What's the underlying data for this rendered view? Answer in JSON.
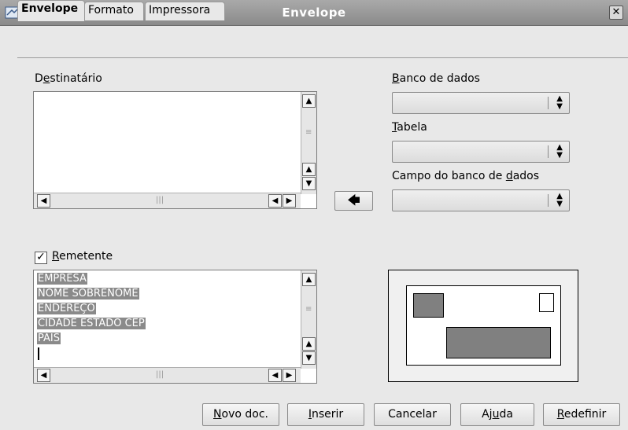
{
  "window": {
    "title": "Envelope",
    "close_label": "✕"
  },
  "tabs": [
    {
      "label": "Envelope",
      "active": true
    },
    {
      "label": "Formato",
      "active": false
    },
    {
      "label": "Impressora",
      "active": false
    }
  ],
  "recipient": {
    "label_pre": "D",
    "label_acc": "e",
    "label_post": "stinatário",
    "value": ""
  },
  "database": {
    "label_acc": "B",
    "label_post": "anco de dados",
    "value": ""
  },
  "table": {
    "label_acc": "T",
    "label_post": "abela",
    "value": ""
  },
  "db_field": {
    "label_pre": "Campo do banco de ",
    "label_acc": "d",
    "label_post": "ados",
    "value": ""
  },
  "insert_arrow": {
    "icon": "arrow-left-icon",
    "glyph": "🡄"
  },
  "sender": {
    "checked": true,
    "check_glyph": "✓",
    "label_acc": "R",
    "label_post": "emetente",
    "lines": [
      "EMPRESA",
      "NOME SOBRENOME",
      "ENDEREÇO",
      "CIDADE ESTADO CEP",
      "PAIS"
    ]
  },
  "scroll_glyphs": {
    "up": "▲",
    "down": "▼",
    "left": "◀",
    "right": "▶",
    "grip": "|||",
    "vgrip": "≡"
  },
  "buttons": {
    "new_doc": {
      "acc": "N",
      "post": "ovo doc."
    },
    "insert": {
      "acc": "I",
      "post": "nserir"
    },
    "cancel": {
      "label": "Cancelar"
    },
    "help": {
      "pre": "Aj",
      "acc": "u",
      "post": "da"
    },
    "reset": {
      "acc": "R",
      "post": "edefinir"
    }
  },
  "colors": {
    "selection": "#8a8a8a",
    "titlebar": "#999999",
    "preview_fill": "#808080"
  }
}
